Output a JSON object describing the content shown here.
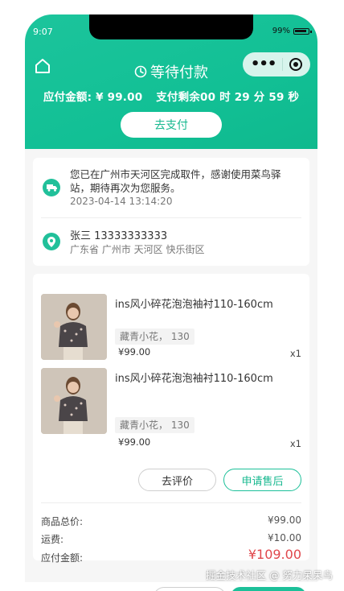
{
  "status_bar": {
    "time": "9:07",
    "battery": "99%"
  },
  "header": {
    "title": "等待付款",
    "payable_text": "应付金额: ¥ 99.00",
    "countdown_text": "支付剩余00 时 29 分 59 秒",
    "pay_button": "去支付"
  },
  "logistics": {
    "message": "您已在广州市天河区完成取件，感谢使用菜鸟驿站，期待再次为您服务。",
    "time": "2023-04-14 13:14:20"
  },
  "address": {
    "name_phone": "张三 13333333333",
    "detail": "广东省 广州市 天河区 快乐街区"
  },
  "items": [
    {
      "name": "ins风小碎花泡泡袖衬110-160cm",
      "sku": "藏青小花， 130",
      "price": "¥99.00",
      "qty": "x1"
    },
    {
      "name": "ins风小碎花泡泡袖衬110-160cm",
      "sku": "藏青小花， 130",
      "price": "¥99.00",
      "qty": "x1"
    }
  ],
  "actions": {
    "review": "去评价",
    "after_sale": "申请售后"
  },
  "summary": {
    "total_label": "商品总价:",
    "total_value": "¥99.00",
    "shipping_label": "运费:",
    "shipping_value": "¥10.00",
    "payable_label": "应付金额:",
    "payable_value": "¥109.00"
  },
  "watermark": "掘金技术社区 @ 努力呆呆鸟",
  "colors": {
    "accent": "#17c095",
    "price_red": "#e0474c"
  }
}
